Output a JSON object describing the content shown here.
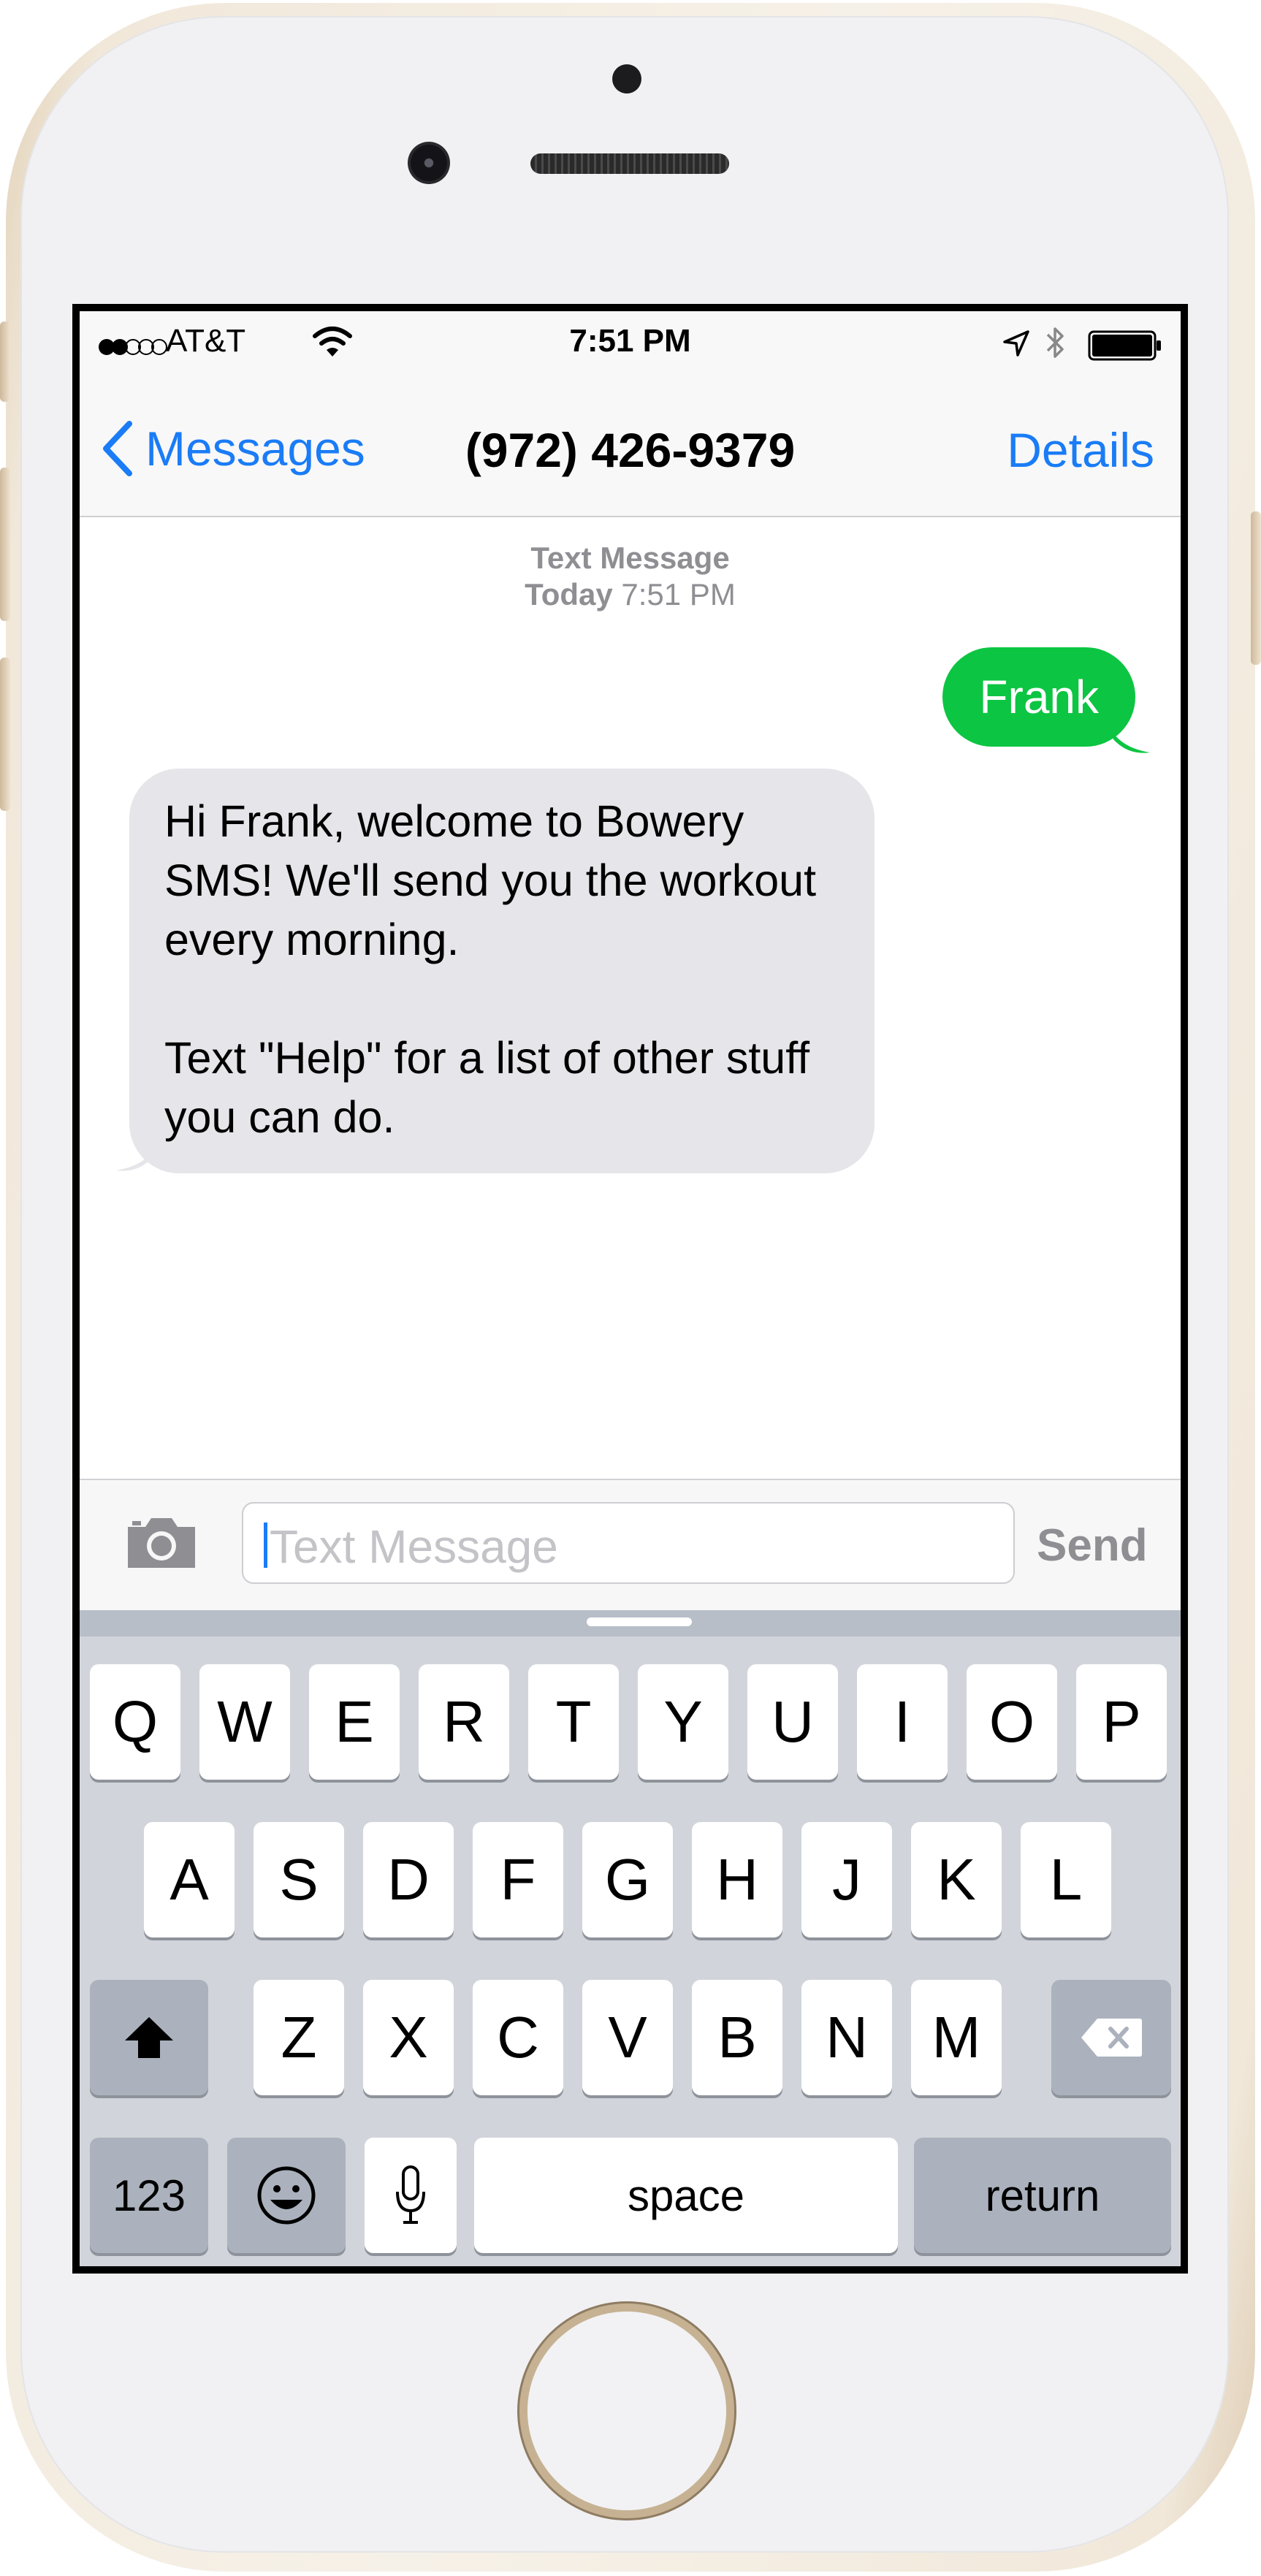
{
  "status_bar": {
    "signal_filled": 2,
    "signal_total": 5,
    "carrier": "AT&T",
    "time": "7:51 PM"
  },
  "nav": {
    "back_label": "Messages",
    "title": "(972) 426-9379",
    "details_label": "Details"
  },
  "conversation": {
    "header_line1": "Text Message",
    "header_day": "Today",
    "header_time": "7:51 PM",
    "outgoing": "Frank",
    "incoming_p1": "Hi Frank, welcome to Bowery SMS! We'll send you the workout every morning.",
    "incoming_p2": "Text \"Help\" for a list of other stuff you can do."
  },
  "input": {
    "placeholder": "Text Message",
    "send_label": "Send"
  },
  "keyboard": {
    "row1": [
      "Q",
      "W",
      "E",
      "R",
      "T",
      "Y",
      "U",
      "I",
      "O",
      "P"
    ],
    "row2": [
      "A",
      "S",
      "D",
      "F",
      "G",
      "H",
      "J",
      "K",
      "L"
    ],
    "row3": [
      "Z",
      "X",
      "C",
      "V",
      "B",
      "N",
      "M"
    ],
    "numbers_label": "123",
    "space_label": "space",
    "return_label": "return"
  },
  "colors": {
    "accent_blue": "#1a7cf6",
    "outgoing_bubble": "#0cc542",
    "incoming_bubble": "#e5e5ea"
  },
  "icons": [
    "wifi-icon",
    "location-arrow-icon",
    "bluetooth-icon",
    "battery-icon",
    "chevron-left-icon",
    "camera-icon",
    "shift-icon",
    "backspace-icon",
    "emoji-icon",
    "microphone-icon"
  ]
}
